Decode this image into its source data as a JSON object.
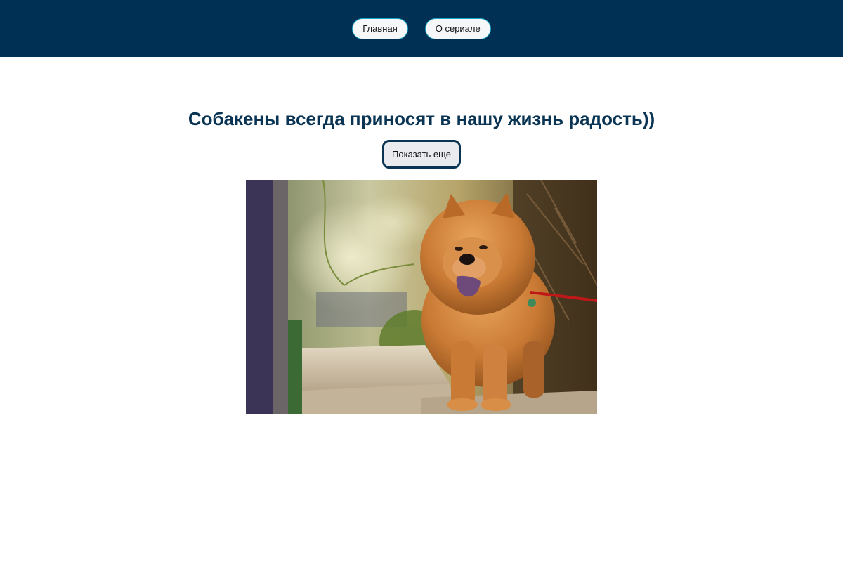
{
  "nav": {
    "items": [
      {
        "label": "Главная"
      },
      {
        "label": "О сериале"
      }
    ]
  },
  "main": {
    "title": "Собакены всегда приносят в нашу жизнь радость))",
    "more_button": "Показать еще"
  },
  "colors": {
    "header_bg": "#003155",
    "title": "#0a3453",
    "nav_border": "#1aa6c4"
  }
}
